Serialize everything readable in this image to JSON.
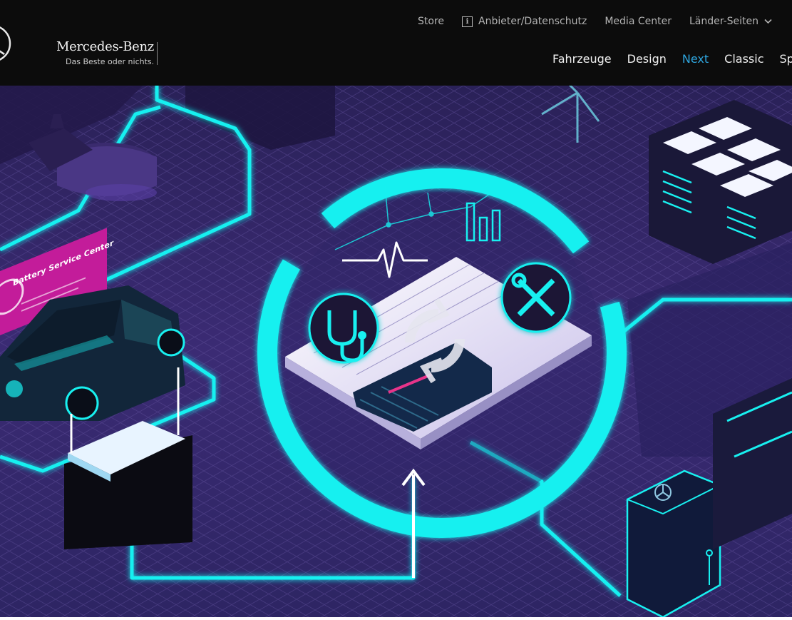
{
  "brand": {
    "name": "Mercedes-Benz",
    "slogan": "Das Beste oder nichts."
  },
  "utility_nav": {
    "items": [
      {
        "label": "Store"
      },
      {
        "label": "Anbieter/Datenschutz",
        "icon": "info-icon",
        "icon_glyph": "i"
      },
      {
        "label": "Media Center"
      },
      {
        "label": "Länder-Seiten",
        "icon": "chevron-down-icon"
      }
    ]
  },
  "main_nav": {
    "items": [
      {
        "label": "Fahrzeuge"
      },
      {
        "label": "Design"
      },
      {
        "label": "Next",
        "active": true
      },
      {
        "label": "Classic"
      },
      {
        "label": "Sport"
      }
    ]
  },
  "hero": {
    "battery_sign": "Battery Service Center",
    "icons": [
      "stethoscope-icon",
      "refresh-icon",
      "wrench-screwdriver-icon",
      "heartbeat-icon",
      "bar-chart-icon",
      "wind-turbine-icon",
      "mercedes-star-icon"
    ]
  },
  "colors": {
    "header_bg": "#0c0c0c",
    "nav_active": "#2fa7e0",
    "neon_cyan": "#18f0f0",
    "scene_purple": "#3a2a72",
    "sign_magenta": "#c31c9a"
  }
}
